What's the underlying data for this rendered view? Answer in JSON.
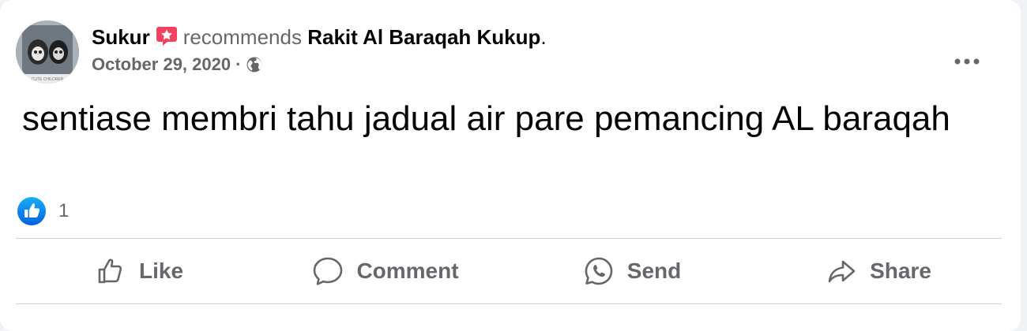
{
  "post": {
    "author": "Sukur",
    "verb": "recommends",
    "page_name": "Rakit Al Baraqah Kukup",
    "period": ".",
    "date": "October 29, 2020",
    "separator": "·",
    "audience_icon": "globe-icon",
    "avatar_caption": "CUTE CHILDREN",
    "text": "sentiase membri tahu jadual air pare pemancing AL baraqah"
  },
  "reactions": {
    "icon": "thumbs-up-icon",
    "count": "1"
  },
  "actions": [
    {
      "label": "Like",
      "icon": "thumbs-up-outline-icon"
    },
    {
      "label": "Comment",
      "icon": "speech-bubble-icon"
    },
    {
      "label": "Send",
      "icon": "whatsapp-icon"
    },
    {
      "label": "Share",
      "icon": "share-arrow-icon"
    }
  ],
  "colors": {
    "recommend_badge": "#f3425f",
    "like_blue": "#1877f2",
    "secondary_text": "#65676b",
    "primary_text": "#050505"
  }
}
